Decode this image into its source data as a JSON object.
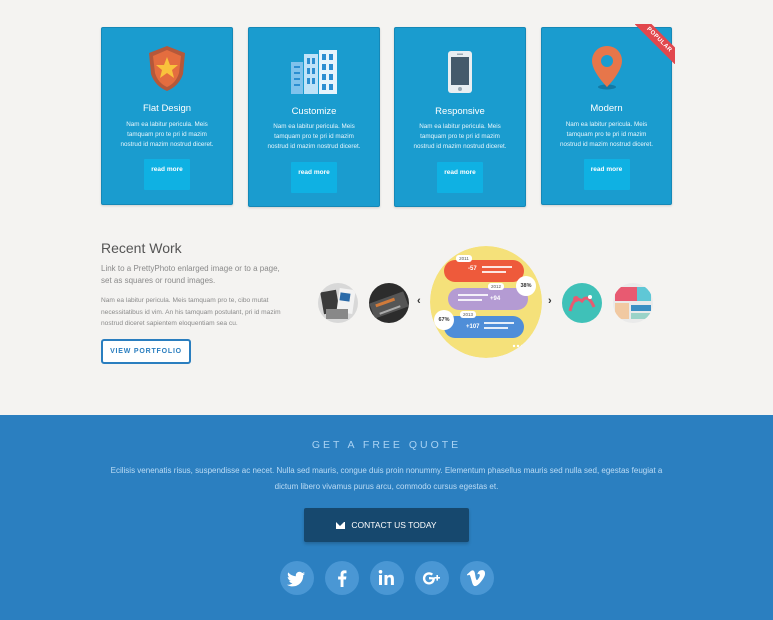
{
  "features": [
    {
      "title": "Flat Design",
      "desc": "Nam ea labitur pericula. Meis tamquam pro te pri id mazim nostrud id mazim nostrud diceret.",
      "button": "read more",
      "icon": "shield-star-icon"
    },
    {
      "title": "Customize",
      "desc": "Nam ea labitur pericula. Meis tamquam pro te pri id mazim nostrud id mazim nostrud diceret.",
      "button": "read more",
      "icon": "buildings-icon"
    },
    {
      "title": "Responsive",
      "desc": "Nam ea labitur pericula. Meis tamquam pro te pri id mazim nostrud id mazim nostrud diceret.",
      "button": "read more",
      "icon": "smartphone-icon"
    },
    {
      "title": "Modern",
      "desc": "Nam ea labitur pericula. Meis tamquam pro te pri id mazim nostrud id mazim nostrud diceret.",
      "button": "read more",
      "icon": "map-pin-icon",
      "badge": "POPULAR"
    }
  ],
  "recent_work": {
    "title": "Recent Work",
    "subtitle": "Link to a PrettyPhoto enlarged image or to a page, set as squares or round images.",
    "text": "Nam ea labitur pericula. Meis tamquam pro te, cibo mutat necessitatibus id vim. An his tamquam postulant, pri id mazim nostrud diceret sapientem eloquentiam sea cu.",
    "button": "VIEW PORTFOLIO",
    "prev": "‹",
    "next": "›",
    "infographic": {
      "years": [
        "2011",
        "2012",
        "2013"
      ],
      "values": [
        "-57",
        "+94",
        "+107"
      ],
      "percents": [
        "38%",
        "67%"
      ]
    }
  },
  "quote": {
    "title": "GET A FREE QUOTE",
    "text": "Ecilisis venenatis risus, suspendisse ac necet. Nulla sed mauris, congue duis proin nonummy. Elementum phasellus mauris sed nulla sed, egestas feugiat a dictum libero vivamus purus arcu, commodo cursus egestas et.",
    "button": "CONTACT US TODAY"
  },
  "social": [
    {
      "name": "twitter",
      "glyph": "t"
    },
    {
      "name": "facebook",
      "glyph": "f"
    },
    {
      "name": "linkedin",
      "glyph": "in"
    },
    {
      "name": "google-plus",
      "glyph": "g+"
    },
    {
      "name": "vimeo",
      "glyph": "v"
    }
  ],
  "colors": {
    "card_blue": "#1a9ccf",
    "band_blue": "#2b7fc0",
    "button_dark": "#16486e",
    "accent_red": "#e2474d"
  }
}
